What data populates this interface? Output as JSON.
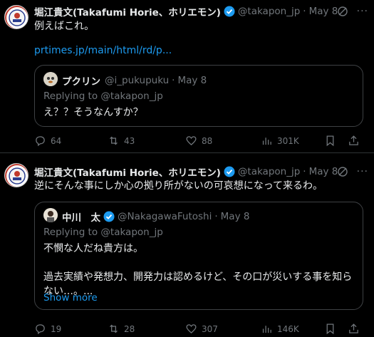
{
  "colors": {
    "accent": "#1d9bf0",
    "muted": "#71767b",
    "text": "#e7e9ea",
    "border": "#2f3336"
  },
  "tweets": [
    {
      "author": {
        "name": "堀江貴文(Takafumi Horie、ホリエモン)",
        "handle": "@takapon_jp",
        "date": "May 8"
      },
      "text": "例えばこれ。",
      "link": "prtimes.jp/main/html/rd/p...",
      "quote": {
        "author": {
          "name": "プクリン",
          "handle": "@i_pukupuku",
          "date": "May 8"
        },
        "reply_to": "Replying to @takapon_jp",
        "lines": [
          "え？？そうなんすか？"
        ]
      },
      "stats": {
        "replies": "64",
        "retweets": "43",
        "likes": "88",
        "views": "301K"
      }
    },
    {
      "author": {
        "name": "堀江貴文(Takafumi Horie、ホリエモン)",
        "handle": "@takapon_jp",
        "date": "May 8"
      },
      "text": "逆にそんな事にしか心の拠り所がないの可哀想になって来るわ。",
      "quote": {
        "author": {
          "name": "中川　太",
          "handle": "@NakagawaFutoshi",
          "date": "May 8"
        },
        "reply_to": "Replying to @takapon_jp",
        "lines": [
          "不憫な人だね貴方は。",
          "",
          "過去実績や発想力、開発力は認めるけど、その口が災いする事を知ら",
          "ない…。..."
        ],
        "show_more": "Show more"
      },
      "stats": {
        "replies": "19",
        "retweets": "28",
        "likes": "307",
        "views": "146K"
      }
    }
  ],
  "icons": {
    "verified": "verified-badge-icon",
    "grok": "grok-icon",
    "more": "more-icon",
    "reply": "reply-icon",
    "retweet": "retweet-icon",
    "like": "heart-icon",
    "views": "views-icon",
    "bookmark": "bookmark-icon",
    "share": "share-icon"
  }
}
